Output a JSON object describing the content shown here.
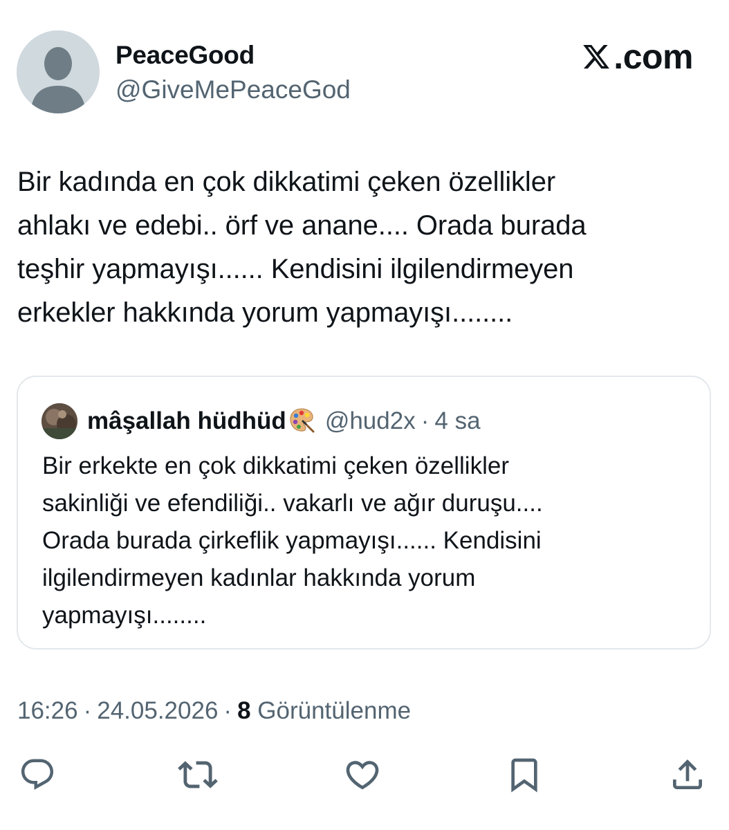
{
  "author": {
    "display_name": "PeaceGood",
    "handle": "@GiveMePeaceGod",
    "avatar_icon": "default-avatar-icon"
  },
  "brand": {
    "logo_icon": "x-logo-icon",
    "text": ".com"
  },
  "tweet": {
    "text": "Bir kadında en çok dikkatimi çeken özellikler\nahlakı ve edebi.. örf ve anane.... Orada burada\nteşhir yapmayışı...... Kendisini ilgilendirmeyen\nerkekler hakkında yorum yapmayışı........"
  },
  "quote": {
    "display_name": "mâşallah hüdhüd",
    "emoji_icon": "artist-palette-icon",
    "handle": "@hud2x",
    "separator": "·",
    "time": "4 sa",
    "text": "Bir erkekte en çok dikkatimi çeken özellikler\nsakinliği ve efendiliği.. vakarlı ve ağır duruşu....\nOrada burada çirkeflik yapmayışı...... Kendisini\nilgilendirmeyen kadınlar hakkında yorum\nyapmayışı........"
  },
  "meta": {
    "time": "16:26",
    "separator": "·",
    "date": "24.05.2026",
    "views_count": "8",
    "views_label": "Görüntülenme"
  },
  "actions": [
    {
      "icon": "reply-icon"
    },
    {
      "icon": "retweet-icon"
    },
    {
      "icon": "like-icon"
    },
    {
      "icon": "bookmark-icon"
    },
    {
      "icon": "share-icon"
    }
  ],
  "colors": {
    "text_primary": "#0f1419",
    "text_secondary": "#536471",
    "border": "#e3e8ec",
    "avatar_bg": "#cfd9de",
    "avatar_fg": "#6f7d86"
  }
}
